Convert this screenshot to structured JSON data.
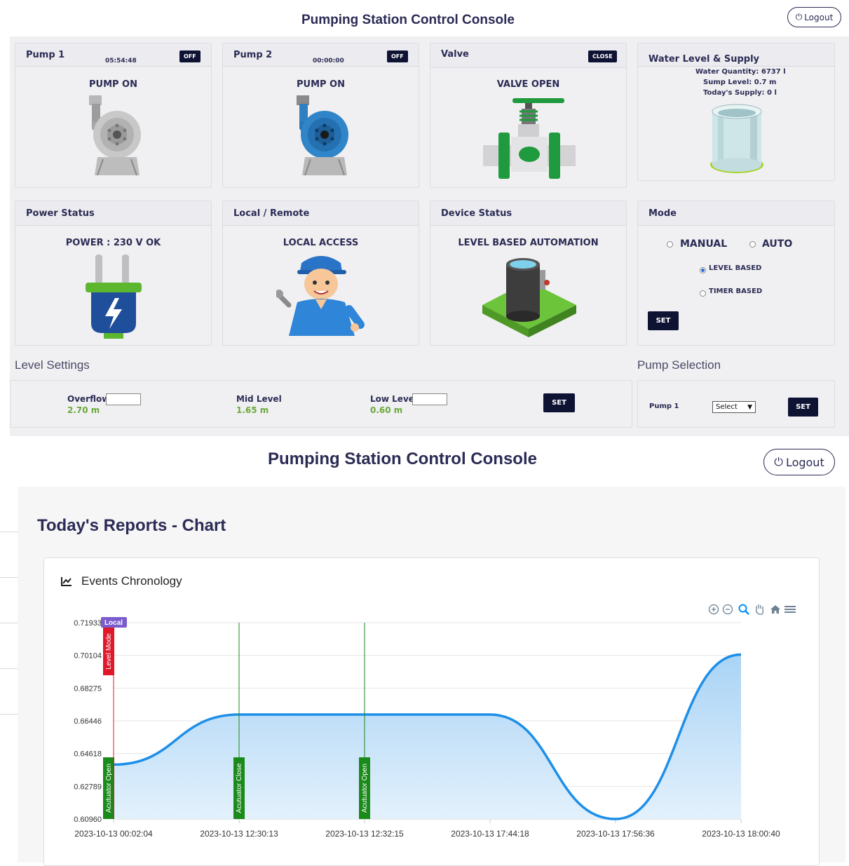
{
  "top": {
    "title": "Pumping Station Control Console",
    "logout_label": "Logout"
  },
  "cards": {
    "pump1": {
      "title": "Pump 1",
      "timer": "05:54:48",
      "badge": "OFF",
      "status": "PUMP ON"
    },
    "pump2": {
      "title": "Pump 2",
      "timer": "00:00:00",
      "badge": "OFF",
      "status": "PUMP ON"
    },
    "valve": {
      "title": "Valve",
      "badge": "CLOSE",
      "status": "VALVE OPEN"
    },
    "water": {
      "title": "Water Level & Supply",
      "quantity": "Water Quantity: 6737 l",
      "sump": "Sump Level: 0.7 m",
      "supply": "Today's Supply: 0 l"
    },
    "power": {
      "title": "Power Status",
      "status": "POWER : 230 V OK"
    },
    "local": {
      "title": "Local / Remote",
      "status": "LOCAL ACCESS"
    },
    "device": {
      "title": "Device Status",
      "status": "LEVEL BASED AUTOMATION"
    },
    "mode": {
      "title": "Mode",
      "manual": "MANUAL",
      "auto": "AUTO",
      "level_based": "LEVEL BASED",
      "timer_based": "TIMER BASED",
      "set": "SET",
      "selected": "LEVEL BASED"
    }
  },
  "level_settings": {
    "title": "Level Settings",
    "overflow_label": "Overflow",
    "overflow_value": "2.70 m",
    "mid_label": "Mid Level",
    "mid_value": "1.65 m",
    "low_label": "Low Level",
    "low_value": "0.60 m",
    "set": "SET"
  },
  "pump_selection": {
    "title": "Pump Selection",
    "pump_label": "Pump 1",
    "select_value": "Select",
    "set": "SET"
  },
  "second": {
    "title": "Pumping Station Control Console",
    "logout_label": "Logout",
    "reports_title": "Today's Reports - Chart",
    "chart_title": "Events Chronology"
  },
  "colors": {
    "navy": "#0f1333",
    "series": "#1e8fe8",
    "area": "#a9d3f5",
    "event_green": "#1a8a1a",
    "mode_red": "#e0182a",
    "local_purple": "#7a5ccd",
    "value_green": "#6aa93a"
  },
  "chart_data": {
    "type": "area",
    "title": "Events Chronology",
    "x": [
      "2023-10-13 00:02:04",
      "2023-10-13 12:30:13",
      "2023-10-13 12:32:15",
      "2023-10-13 17:44:18",
      "2023-10-13 17:56:36",
      "2023-10-13 18:00:40"
    ],
    "y_ticks": [
      "0.71933",
      "0.70104",
      "0.68275",
      "0.66446",
      "0.64618",
      "0.62789",
      "0.60960"
    ],
    "ylim": [
      0.6096,
      0.71933
    ],
    "series": [
      {
        "values": [
          0.64,
          0.668,
          0.668,
          0.668,
          0.6096,
          0.7015
        ]
      }
    ],
    "annotations": [
      {
        "x": "2023-10-13 00:02:04",
        "label": "Acutuator Open",
        "color": "#1a8a1a"
      },
      {
        "x": "2023-10-13 12:30:13",
        "label": "Acutuator Close",
        "color": "#1a8a1a"
      },
      {
        "x": "2023-10-13 12:32:15",
        "label": "Acutuator Open",
        "color": "#1a8a1a"
      },
      {
        "x": "2023-10-13 00:02:04",
        "label": "Level Mode",
        "color": "#e0182a"
      },
      {
        "x": "2023-10-13 00:02:04",
        "label": "Local",
        "color": "#7a5ccd"
      }
    ],
    "toolbar": [
      "zoom-in-icon",
      "zoom-out-icon",
      "selection-zoom-icon",
      "pan-icon",
      "home-icon",
      "menu-icon"
    ],
    "grid": true
  }
}
